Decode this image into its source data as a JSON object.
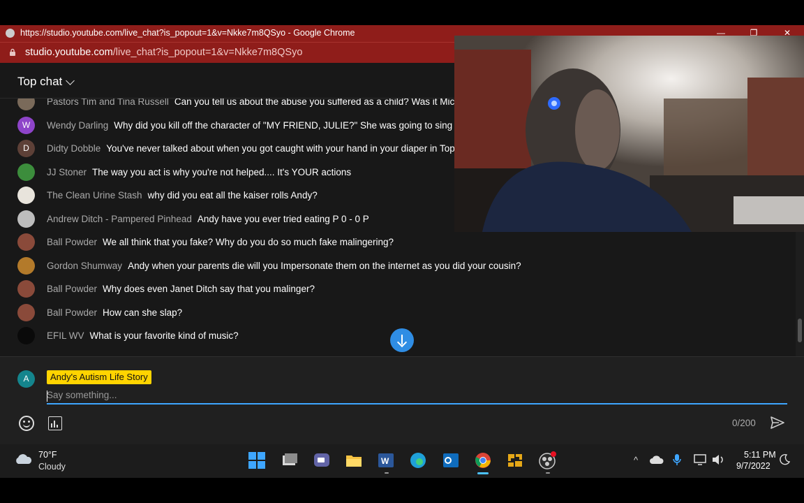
{
  "browser": {
    "window_title": "https://studio.youtube.com/live_chat?is_popout=1&v=Nkke7m8QSyo - Google Chrome",
    "url_domain": "studio.youtube.com",
    "url_path": "/live_chat?is_popout=1&v=Nkke7m8QSyo",
    "minimize_glyph": "—",
    "restore_glyph": "❐",
    "close_glyph": "✕"
  },
  "chat": {
    "header_label": "Top chat",
    "messages": [
      {
        "author": "Pastors Tim and Tina Russell",
        "text": "Can you tell us about the abuse you suffered as a child? Was it Mic",
        "avatar_color": "#7a6a5a",
        "avatar_letter": ""
      },
      {
        "author": "Wendy Darling",
        "text": "Why did you kill off the character of \"MY FRIEND, JULIE?\" She was going to sing a",
        "avatar_color": "#8e44c9",
        "avatar_letter": "W"
      },
      {
        "author": "Didty Dobble",
        "text": "You've never talked about when you got caught with your hand in your diaper in Top",
        "avatar_color": "#5d4037",
        "avatar_letter": "D"
      },
      {
        "author": "JJ Stoner",
        "text": "The way you act is why you're not helped.... It's YOUR actions",
        "avatar_color": "#3c8d3c",
        "avatar_letter": ""
      },
      {
        "author": "The Clean Urine Stash",
        "text": "why did you eat all the kaiser rolls Andy?",
        "avatar_color": "#e8e4dc",
        "avatar_letter": ""
      },
      {
        "author": "Andrew Ditch - Pampered Pinhead",
        "text": "Andy have you ever tried eating P 0 - 0 P",
        "avatar_color": "#bdbdbd",
        "avatar_letter": ""
      },
      {
        "author": "Ball Powder",
        "text": "We all think that you fake? Why do you do so much fake malingering?",
        "avatar_color": "#8a4a3a",
        "avatar_letter": ""
      },
      {
        "author": "Gordon Shumway",
        "text": "Andy when your parents die will you Impersonate them on the internet as you did your cousin?",
        "avatar_color": "#b37a2a",
        "avatar_letter": ""
      },
      {
        "author": "Ball Powder",
        "text": "Why does even Janet Ditch say that you malinger?",
        "avatar_color": "#8a4a3a",
        "avatar_letter": ""
      },
      {
        "author": "Ball Powder",
        "text": "How can she slap?",
        "avatar_color": "#8a4a3a",
        "avatar_letter": ""
      },
      {
        "author": "EFIL WV",
        "text": "What is your favorite kind of music?",
        "avatar_color": "#0a0a0a",
        "avatar_letter": ""
      }
    ]
  },
  "composer": {
    "avatar_letter": "A",
    "channel_name": "Andy's Autism Life Story",
    "placeholder": "Say something...",
    "char_counter": "0/200",
    "emoji_icon": "emoji-icon",
    "poll_icon": "poll-icon",
    "send_icon": "send-icon"
  },
  "taskbar": {
    "weather_temp": "70°F",
    "weather_condition": "Cloudy",
    "time": "5:11 PM",
    "date": "9/7/2022",
    "tray_chevron": "^"
  },
  "colors": {
    "titlebar": "#8f1d1a",
    "chat_bg": "#181818",
    "accent": "#3ea6ff",
    "owner_chip": "#ffd400"
  }
}
